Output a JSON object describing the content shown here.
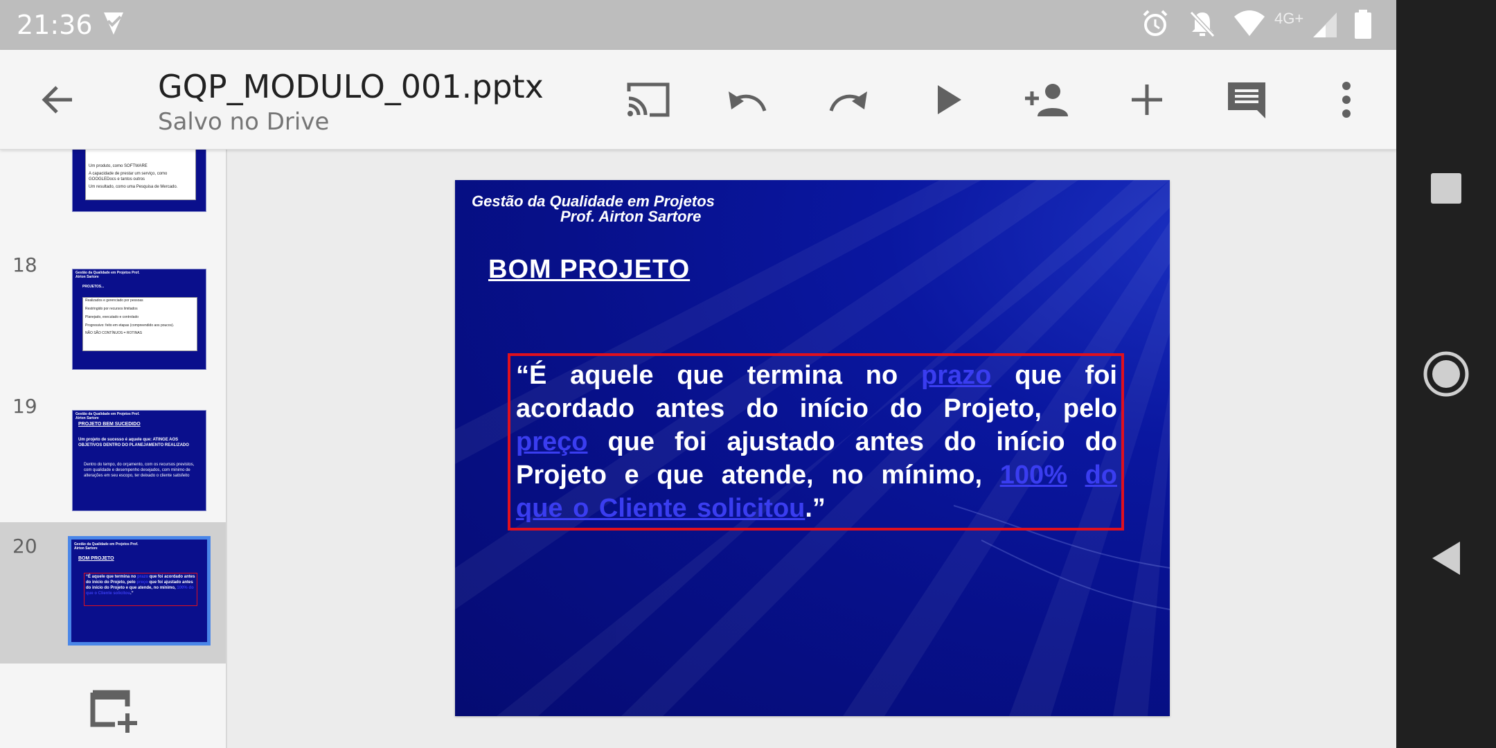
{
  "status_bar": {
    "time": "21:36",
    "network_label": "4G+",
    "icons": [
      "download-check-icon",
      "alarm-icon",
      "notifications-off-icon",
      "wifi-icon",
      "signal-icon",
      "battery-icon"
    ]
  },
  "toolbar": {
    "file_name": "GQP_MODULO_001.pptx",
    "save_status": "Salvo no Drive",
    "actions": [
      "back",
      "cast",
      "undo",
      "redo",
      "present",
      "add-person",
      "insert",
      "comments",
      "more"
    ]
  },
  "filmstrip": {
    "slides": [
      {
        "number": "",
        "lines": [
          "Um produto, como SOFTWARE",
          "A capacidade de prestar um serviço, como GOOGLEDocs e tantos outros",
          "Um resultado, como uma Pesquisa de Mercado."
        ]
      },
      {
        "number": "18",
        "header": "Gestão da Qualidade em Projetos Prof. Airton Sartore",
        "title": "PROJETOS...",
        "lines": [
          "Realizados e gerenciado por pessoas",
          "Restringido por recursos limitados",
          "Planejado, executado e controlado",
          "Progressivo: feito em etapas (compreendido aos poucos).",
          "NÃO SÃO CONTÍNUOS = ROTINAS"
        ]
      },
      {
        "number": "19",
        "header": "Gestão da Qualidade em Projetos Prof. Airton Sartore",
        "title": "PROJETO BEM SUCEDIDO",
        "lines": [
          "Um projeto de sucesso é aquele que: ATINGE AOS OBJETIVOS DENTRO DO PLANEJAMENTO REALIZADO",
          "Dentro do tempo, do orçamento, com os recursos previstos, com qualidade e desempenho desejados, com mínimo de alterações em seu escopo, ter deixado o cliente satisfeito"
        ]
      },
      {
        "number": "20",
        "header": "Gestão da Qualidade em Projetos Prof. Airton Sartore",
        "title": "BOM PROJETO",
        "selected": true
      }
    ]
  },
  "slide": {
    "header_line1": "Gestão da Qualidade em Projetos",
    "header_line2": "Prof. Airton Sartore",
    "title": "BOM  PROJETO",
    "quote": {
      "line1_a": "“É aquele que termina no",
      "line1_link": "prazo",
      "line1_b": "que foi",
      "line2": "acordado antes do início do Projeto, pelo",
      "line3_link": "preço",
      "line3_b": "que foi ajustado antes do início do",
      "line4_a": "Projeto e que atende, no mínimo,",
      "line4_link1": "100%",
      "line4_link2": "do",
      "line5_link": "que o Cliente solicitou",
      "line5_end": ".”"
    },
    "colors": {
      "background": "#07108a",
      "box_border": "#e0101e",
      "link": "#3a3df0",
      "text": "#ffffff"
    }
  },
  "colors": {
    "status_bar": "#bdbdbd",
    "toolbar": "#f5f5f5",
    "nav_bar": "#202020",
    "selection": "#4a86e8"
  }
}
